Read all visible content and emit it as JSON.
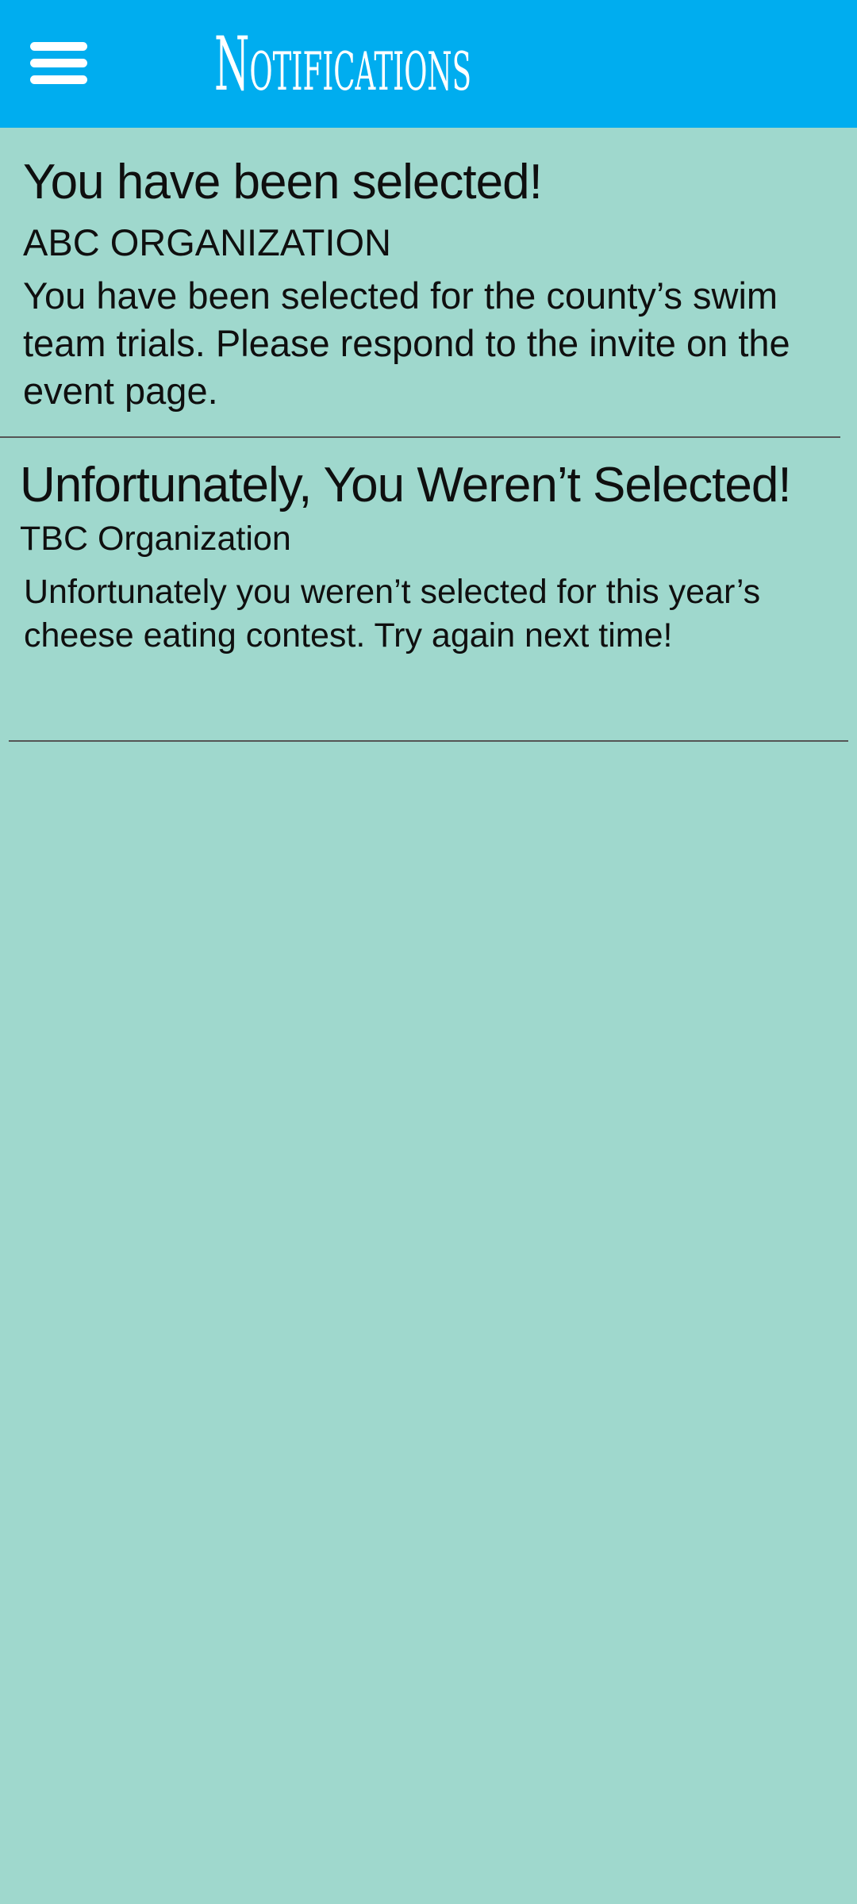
{
  "header": {
    "title": "Notifications",
    "menu_icon": "hamburger-menu-icon",
    "background_color": "#00adef"
  },
  "notifications": [
    {
      "title": "You have been selected!",
      "organization": "ABC  ORGANIZATION",
      "body": "You have been selected for the county’s swim team trials. Please respond to the invite on the event page."
    },
    {
      "title": "Unfortunately, You Weren’t Selected!",
      "organization": "TBC Organization",
      "body": "Unfortunately you weren’t selected for this year’s cheese eating contest. Try again next time!"
    }
  ],
  "colors": {
    "page_background": "#9fd8cd",
    "text": "#0f0f0f",
    "divider": "#555555"
  }
}
